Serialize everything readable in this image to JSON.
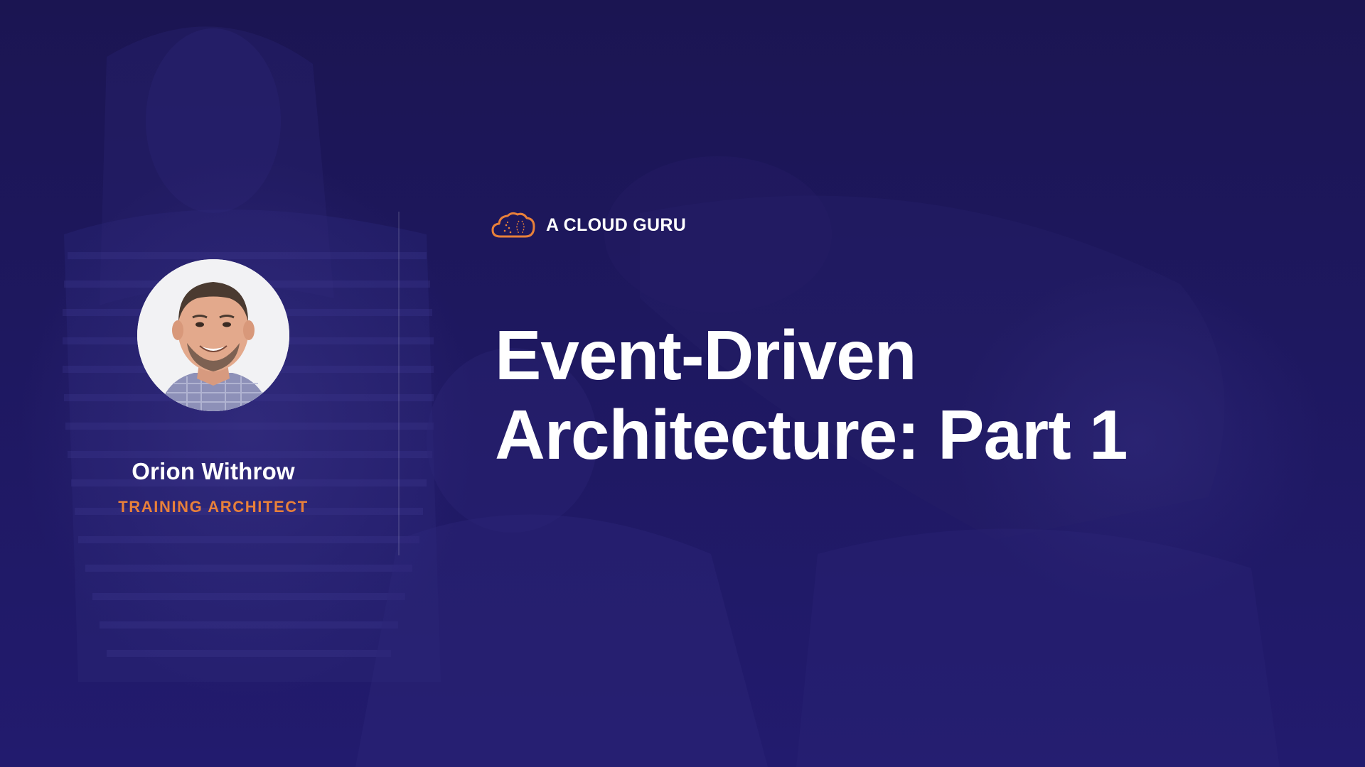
{
  "brand": {
    "name": "A CLOUD GURU",
    "icon": "cloud-logo-icon",
    "accent_color": "#e8803a"
  },
  "course": {
    "title_line1": "Event-Driven",
    "title_line2": "Architecture: Part 1"
  },
  "instructor": {
    "name": "Orion Withrow",
    "role": "TRAINING ARCHITECT",
    "avatar_icon": "instructor-avatar"
  },
  "theme": {
    "background": "#1e1860",
    "text": "#ffffff"
  }
}
